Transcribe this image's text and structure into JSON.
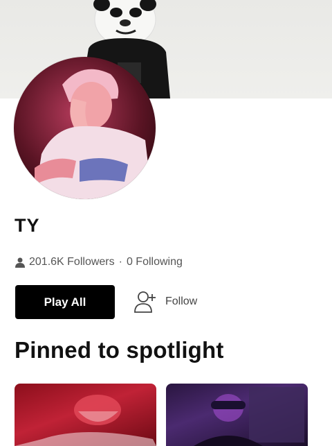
{
  "profile": {
    "name": "TY",
    "followers_text": "201.6K Followers",
    "separator": "·",
    "following_text": "0 Following"
  },
  "actions": {
    "play_all_label": "Play All",
    "follow_label": "Follow"
  },
  "pinned": {
    "title": "Pinned to spotlight"
  },
  "icons": [
    "person-icon",
    "add-person-icon"
  ],
  "colors": {
    "primary_button": "#000000",
    "text_muted": "#555555"
  }
}
